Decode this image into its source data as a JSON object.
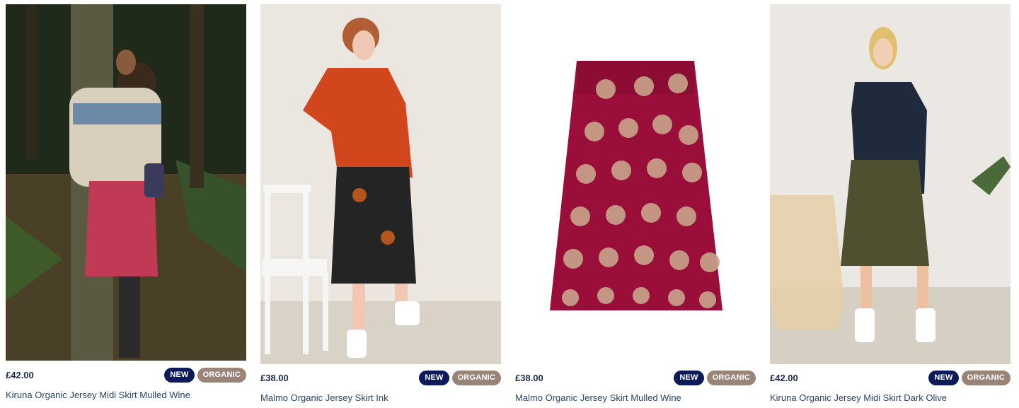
{
  "products": [
    {
      "price": "£42.00",
      "badges": {
        "new": "NEW",
        "organic": "ORGANIC"
      },
      "title": "Kiruna Organic Jersey Midi Skirt Mulled Wine"
    },
    {
      "price": "£38.00",
      "badges": {
        "new": "NEW",
        "organic": "ORGANIC"
      },
      "title": "Malmo Organic Jersey Skirt Ink"
    },
    {
      "price": "£38.00",
      "badges": {
        "new": "NEW",
        "organic": "ORGANIC"
      },
      "title": "Malmo Organic Jersey Skirt Mulled Wine"
    },
    {
      "price": "£42.00",
      "badges": {
        "new": "NEW",
        "organic": "ORGANIC"
      },
      "title": "Kiruna Organic Jersey Midi Skirt Dark Olive"
    }
  ],
  "colors": {
    "badge_new": "#0c1a5a",
    "badge_organic": "#9a8478",
    "price": "#1c2b4a",
    "title": "#2b4466",
    "mulled_wine": "#9a0f3a",
    "ink": "#1d1d1d",
    "dark_olive": "#4f5030"
  }
}
